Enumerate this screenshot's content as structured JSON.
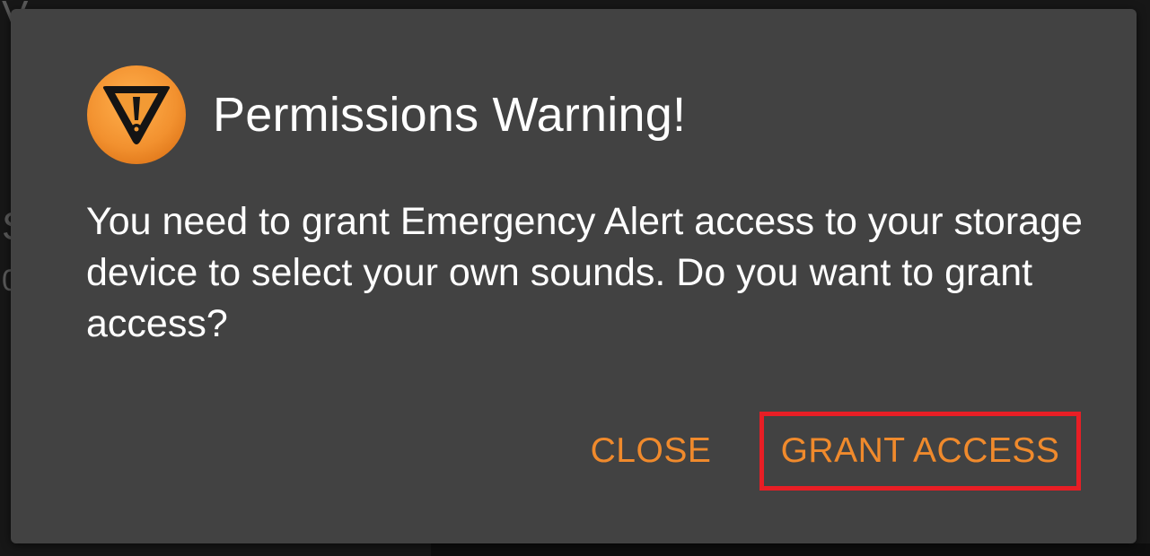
{
  "background": {
    "glyphs": [
      "V",
      "S",
      "0"
    ]
  },
  "dialog": {
    "icon": "warning-triangle-icon",
    "title": "Permissions Warning!",
    "message": "You need to grant Emergency Alert access to your storage device to select your own sounds. Do you want to grant access?",
    "actions": {
      "close_label": "CLOSE",
      "grant_label": "GRANT ACCESS"
    }
  },
  "colors": {
    "dialog_bg": "#424242",
    "accent": "#f08a2c",
    "highlight": "#e81e25",
    "icon_orange": "#f39a3a"
  }
}
